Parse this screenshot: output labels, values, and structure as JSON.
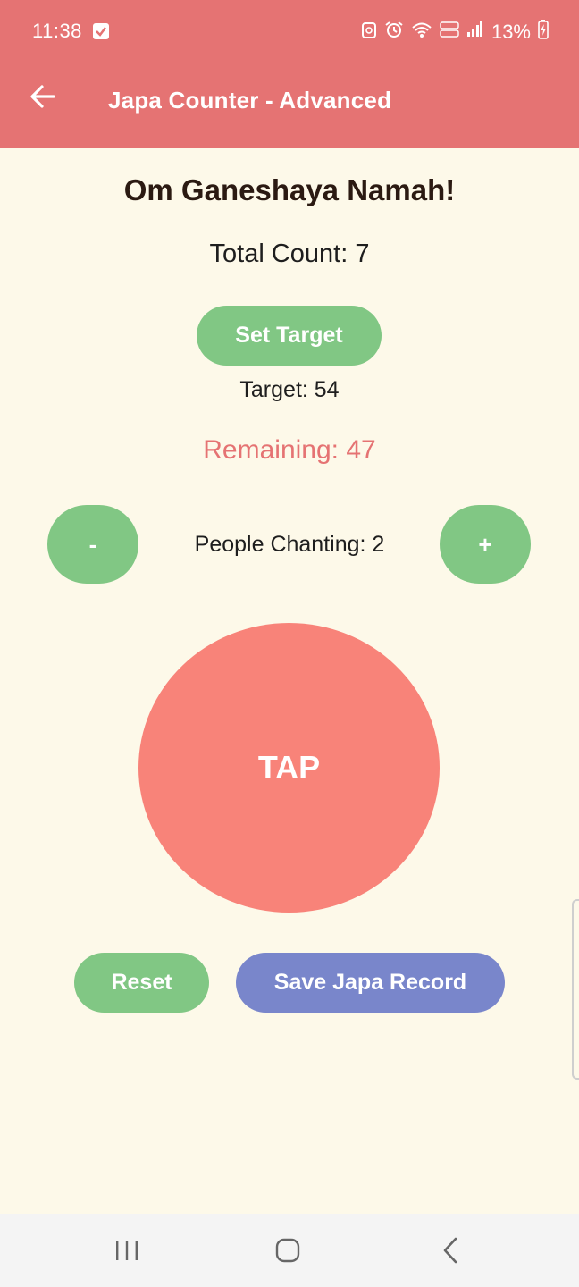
{
  "status_bar": {
    "time": "11:38",
    "battery": "13%",
    "icons": [
      "checkmark-icon",
      "recycle-icon",
      "alarm-icon",
      "wifi-icon",
      "volte-icon",
      "signal-icon",
      "battery-charging-icon"
    ]
  },
  "app_bar": {
    "title": "Japa Counter - Advanced",
    "back_icon": "back-arrow-icon"
  },
  "main": {
    "greeting": "Om Ganeshaya Namah!",
    "total_count": "Total Count: 7",
    "set_target_label": "Set Target",
    "target": "Target: 54",
    "remaining": "Remaining: 47",
    "minus_label": "-",
    "plus_label": "+",
    "people_chanting": "People Chanting: 2",
    "tap_label": "TAP",
    "reset_label": "Reset",
    "save_label": "Save Japa Record"
  },
  "nav_bar": {
    "items": [
      "recents-icon",
      "home-icon",
      "back-icon"
    ]
  },
  "colors": {
    "header": "#e57373",
    "background": "#fdf9e9",
    "green_button": "#81c784",
    "blue_button": "#7986cb",
    "tap_button": "#f88379",
    "remaining_text": "#e57373",
    "heading_text": "#2b1a12"
  }
}
